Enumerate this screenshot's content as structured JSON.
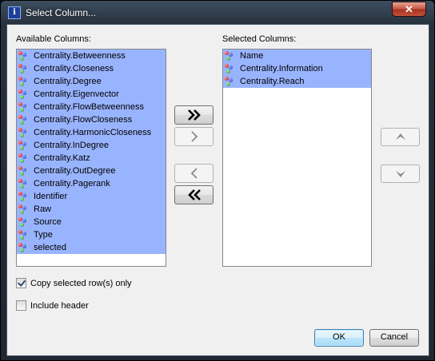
{
  "window": {
    "title": "Select Column...",
    "close_glyph": "✕",
    "app_icon_glyph": "i"
  },
  "available": {
    "label": "Available Columns:",
    "items": [
      "Centrality.Betweenness",
      "Centrality.Closeness",
      "Centrality.Degree",
      "Centrality.Eigenvector",
      "Centrality.FlowBetweenness",
      "Centrality.FlowCloseness",
      "Centrality.HarmonicCloseness",
      "Centrality.InDegree",
      "Centrality.Katz",
      "Centrality.OutDegree",
      "Centrality.Pagerank",
      "Identifier",
      "Raw",
      "Source",
      "Type",
      "selected"
    ]
  },
  "selected": {
    "label": "Selected Columns:",
    "items": [
      "Name",
      "Centrality.Information",
      "Centrality.Reach"
    ]
  },
  "transfer": {
    "add_all_icon": "double-chevron-right-icon",
    "add_icon": "chevron-right-icon",
    "remove_icon": "chevron-left-icon",
    "remove_all_icon": "double-chevron-left-icon"
  },
  "order": {
    "up_icon": "arrow-up-icon",
    "down_icon": "arrow-down-icon"
  },
  "options": {
    "copy_selected_label": "Copy selected row(s) only",
    "copy_selected_checked": true,
    "include_header_label": "Include header",
    "include_header_checked": false
  },
  "buttons": {
    "ok_label": "OK",
    "cancel_label": "Cancel"
  },
  "colors": {
    "selection": "#99b4ff",
    "title_text": "#ffffff",
    "close_button": "#c5523d"
  }
}
